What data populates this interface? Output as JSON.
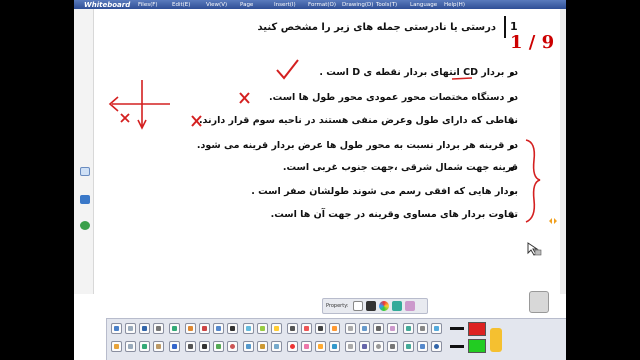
{
  "app": {
    "name": "Whiteboard",
    "menus": [
      "Files(F)",
      "Edit(E)",
      "View(V)",
      "Page",
      "Insert(I)",
      "Format(O)",
      "Drawing(D)",
      "Tools(T)",
      "Language",
      "Help(H)"
    ]
  },
  "lesson": {
    "question_number": "1",
    "question_title": "درستی یا نادرستی جمله های زیر را مشخص کنید",
    "page_counter": "1 / 9",
    "items": [
      "در بردار CD انتهای بردار نقطه ی D است .",
      "در دستگاه مختصات محور عمودی محور طول ها است.",
      "نقاطی که دارای طول وعرض منفی هستند در ناحیه سوم قرار دارند.",
      "در قرینه هر بردار نسبت به محور طول ها عرض بردار قرینه می شود.",
      "قرینه جهت شمال شرقی ،جهت جنوب غربی است.",
      "بردار هایی که افقی رسم می شوند طولشان صفر است .",
      "تفاوت بردار های مساوی وقرینه در جهت آن ها است."
    ]
  },
  "property_bar": {
    "label": "Property:"
  },
  "colors": {
    "ink_red": "#d42020",
    "title_bar": "#2f4f96",
    "page_counter": "#cc0000"
  }
}
